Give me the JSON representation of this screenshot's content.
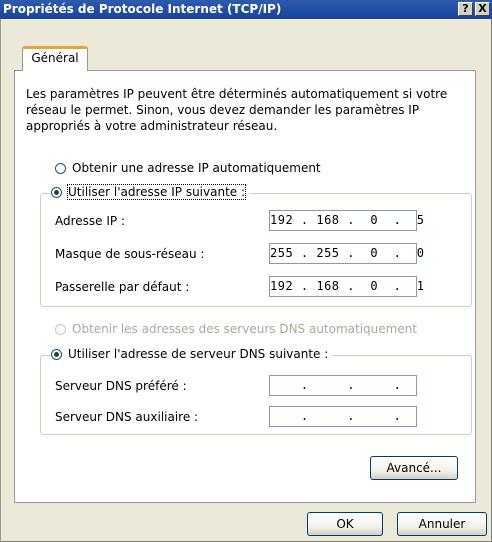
{
  "window": {
    "title": "Propriétés de Protocole Internet (TCP/IP)",
    "help_label": "?",
    "close_label": "X"
  },
  "tabs": [
    {
      "label": "Général",
      "active": true
    }
  ],
  "description": "Les paramètres IP peuvent être déterminés automatiquement si votre réseau le permet. Sinon, vous devez demander les paramètres IP appropriés à votre administrateur réseau.",
  "ip_section": {
    "auto_label": "Obtenir une adresse IP automatiquement",
    "auto_selected": false,
    "manual_label": "Utiliser l'adresse IP suivante :",
    "manual_selected": true,
    "fields": [
      {
        "label": "Adresse IP :",
        "value": "192 . 168 .  0  .  5"
      },
      {
        "label": "Masque de sous-réseau :",
        "value": "255 . 255 .  0  .  0"
      },
      {
        "label": "Passerelle par défaut :",
        "value": "192 . 168 .  0  .  1"
      }
    ]
  },
  "dns_section": {
    "auto_label": "Obtenir les adresses des serveurs DNS automatiquement",
    "auto_enabled": false,
    "manual_label": "Utiliser l'adresse de serveur DNS suivante :",
    "manual_selected": true,
    "fields": [
      {
        "label": "Serveur DNS préféré :",
        "value": "    .     .     .    "
      },
      {
        "label": "Serveur DNS auxiliaire :",
        "value": "    .     .     .    "
      }
    ]
  },
  "buttons": {
    "advanced": "Avancé...",
    "ok": "OK",
    "cancel": "Annuler"
  },
  "colors": {
    "titlebar": "#1e4ca6",
    "dialog_bg": "#ece9d8",
    "tab_highlight": "#e6a63a"
  }
}
